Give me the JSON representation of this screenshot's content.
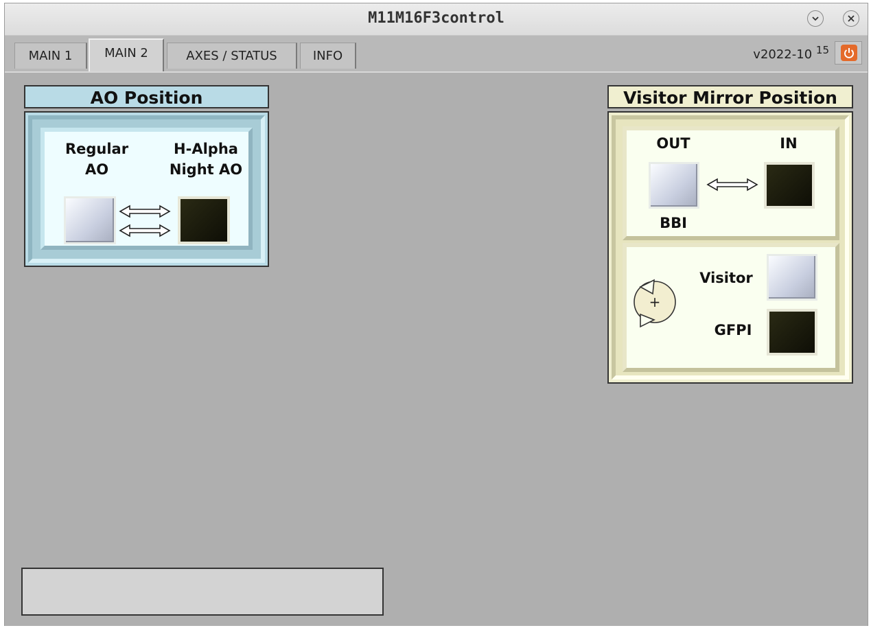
{
  "window": {
    "title": "M11M16F3control"
  },
  "tabs": [
    {
      "label": "MAIN 1"
    },
    {
      "label": "MAIN 2"
    },
    {
      "label": "AXES / STATUS"
    },
    {
      "label": "INFO"
    }
  ],
  "active_tab": "MAIN 2",
  "header": {
    "version": "v2022-10",
    "version_sup": "15"
  },
  "ao_position": {
    "title": "AO Position",
    "left_label_1": "Regular",
    "left_label_2": "AO",
    "right_label_1": "H-Alpha",
    "right_label_2": "Night AO",
    "left_state": "inactive",
    "right_state": "active"
  },
  "visitor_mirror": {
    "title": "Visitor Mirror Position",
    "out_label": "OUT",
    "in_label": "IN",
    "bbi_label": "BBI",
    "visitor_label": "Visitor",
    "gfpi_label": "GFPI",
    "out_state": "inactive",
    "in_state": "active",
    "visitor_state": "inactive",
    "gfpi_state": "active"
  },
  "colors": {
    "ao_panel": "#b9dbe6",
    "ao_inner": "#eefdff",
    "visitor_panel": "#f0efd0",
    "visitor_inner": "#fafff0",
    "content_bg": "#afafaf",
    "active_indicator": "#1a1a0a",
    "power_button": "#e46a2a"
  },
  "icons": {
    "minimize": "chevron-down-icon",
    "close": "close-icon",
    "power": "power-icon",
    "swap": "double-arrow-icon",
    "rotate": "rotate-icon"
  }
}
